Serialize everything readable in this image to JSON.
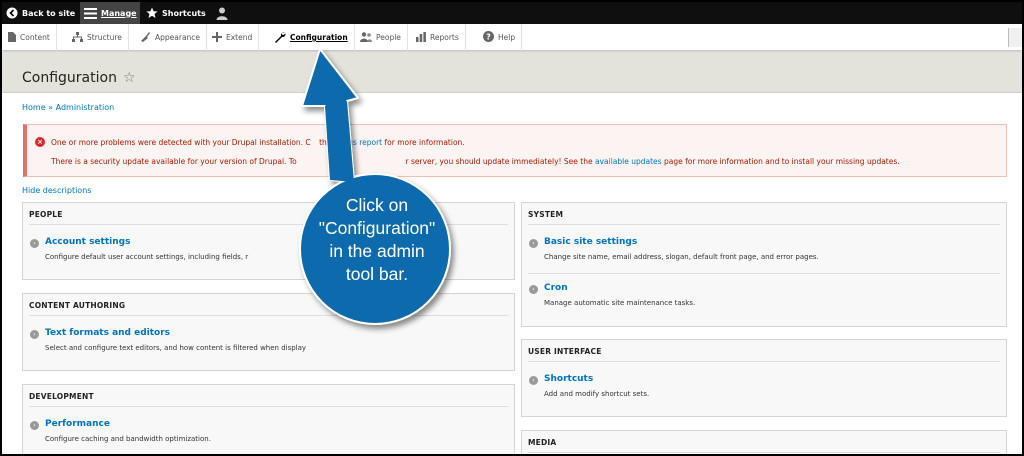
{
  "toolbar": {
    "back_label": "Back to site",
    "manage_label": "Manage",
    "shortcuts_label": "Shortcuts",
    "user_icon": "user-icon"
  },
  "tray": {
    "items": [
      {
        "label": "Content",
        "icon": "content-icon"
      },
      {
        "label": "Structure",
        "icon": "structure-icon"
      },
      {
        "label": "Appearance",
        "icon": "appearance-icon"
      },
      {
        "label": "Extend",
        "icon": "extend-icon"
      },
      {
        "label": "Configuration",
        "icon": "wrench-icon",
        "active": true
      },
      {
        "label": "People",
        "icon": "people-icon"
      },
      {
        "label": "Reports",
        "icon": "reports-icon"
      },
      {
        "label": "Help",
        "icon": "help-icon"
      }
    ]
  },
  "page": {
    "title": "Configuration",
    "breadcrumb": {
      "home": "Home",
      "separator": "»",
      "admin": "Administration"
    }
  },
  "alert": {
    "line1_a": "One or more problems were detected with your Drupal installation. C",
    "line1_link": "status report",
    "line1_mid": "the",
    "line1_b": "for more information.",
    "line2_a": "There is a security update available for your version of Drupal. To",
    "line2_b": "r server, you should update immediately! See the",
    "line2_link": "available updates",
    "line2_c": "page for more information and to install your missing updates."
  },
  "hide_descriptions": "Hide descriptions",
  "panels": {
    "people": {
      "title": "PEOPLE",
      "entries": [
        {
          "link": "Account settings",
          "desc": "Configure default user account settings, including fields, r"
        }
      ]
    },
    "content_authoring": {
      "title": "CONTENT AUTHORING",
      "entries": [
        {
          "link": "Text formats and editors",
          "desc": "Select and configure text editors, and how content is filtered when display"
        }
      ]
    },
    "development": {
      "title": "DEVELOPMENT",
      "entries": [
        {
          "link": "Performance",
          "desc": "Configure caching and bandwidth optimization."
        }
      ]
    },
    "system": {
      "title": "SYSTEM",
      "entries": [
        {
          "link": "Basic site settings",
          "desc": "Change site name, email address, slogan, default front page, and error pages."
        },
        {
          "link": "Cron",
          "desc": "Manage automatic site maintenance tasks."
        }
      ]
    },
    "user_interface": {
      "title": "USER INTERFACE",
      "entries": [
        {
          "link": "Shortcuts",
          "desc": "Add and modify shortcut sets."
        }
      ]
    },
    "media": {
      "title": "MEDIA"
    }
  },
  "callout": {
    "lines": [
      "Click on",
      "\"Configuration\"",
      "in the admin",
      "tool bar."
    ],
    "color": "#0d6bad"
  },
  "colors": {
    "link": "#0074bd",
    "toolbar": "#0f0f0f",
    "error": "#a51b00"
  }
}
